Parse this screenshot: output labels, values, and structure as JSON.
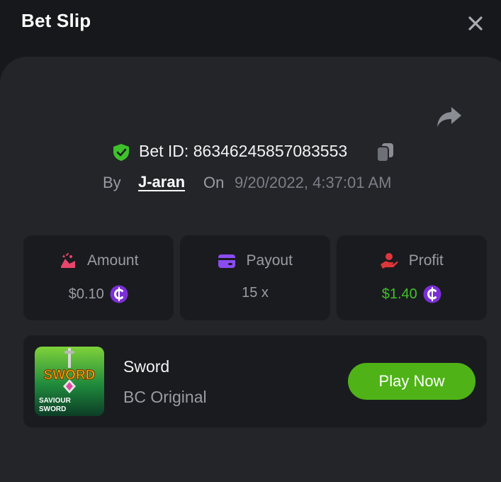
{
  "header": {
    "title": "Bet Slip"
  },
  "bet": {
    "id_label": "Bet ID: 86346245857083553",
    "by_label": "By",
    "user": "J-aran",
    "on_label": "On",
    "datetime": "9/20/2022, 4:37:01 AM"
  },
  "stats": [
    {
      "label": "Amount",
      "value": "$0.10",
      "icon": "amount-icon",
      "color": "#e8456b"
    },
    {
      "label": "Payout",
      "value": "15 x",
      "icon": "wallet-icon",
      "color": "#8a4cf0"
    },
    {
      "label": "Profit",
      "value": "$1.40",
      "icon": "profit-hand-icon",
      "color": "#e0363a"
    }
  ],
  "game": {
    "name": "Sword",
    "category": "BC Original",
    "thumb_title": "SWORD",
    "thumb_caption_line1": "SAVIOUR",
    "thumb_caption_line2": "SWORD",
    "play_label": "Play Now"
  },
  "colors": {
    "accent_green": "#4fb317",
    "profit_green": "#3fc12b",
    "verified_green": "#3fc12b",
    "coin_purple": "#7b2fd6"
  }
}
